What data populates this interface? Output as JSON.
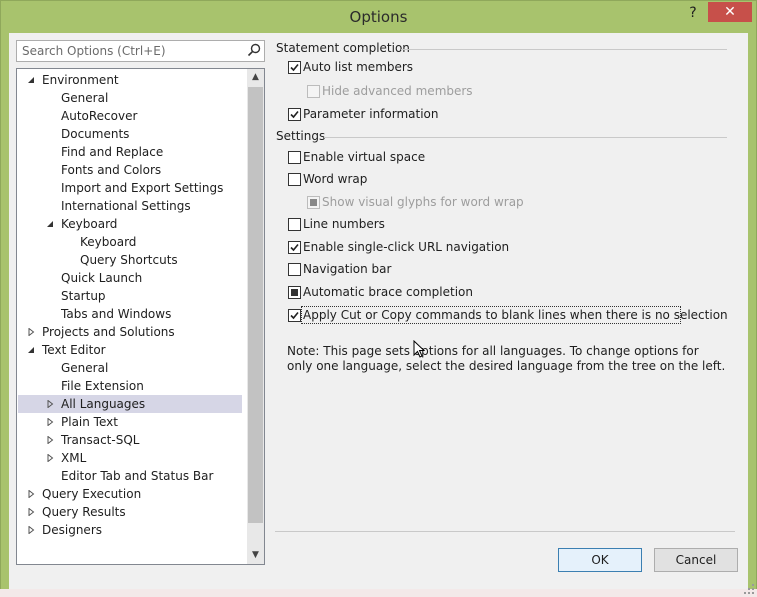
{
  "window": {
    "title": "Options",
    "help_label": "?",
    "close_label": "✕"
  },
  "search": {
    "placeholder": "Search Options (Ctrl+E)"
  },
  "tree": {
    "items": [
      {
        "label": "Environment",
        "expander": "expanded"
      },
      {
        "label": "General"
      },
      {
        "label": "AutoRecover"
      },
      {
        "label": "Documents"
      },
      {
        "label": "Find and Replace"
      },
      {
        "label": "Fonts and Colors"
      },
      {
        "label": "Import and Export Settings"
      },
      {
        "label": "International Settings"
      },
      {
        "label": "Keyboard",
        "expander": "expanded"
      },
      {
        "label": "Keyboard"
      },
      {
        "label": "Query Shortcuts"
      },
      {
        "label": "Quick Launch"
      },
      {
        "label": "Startup"
      },
      {
        "label": "Tabs and Windows"
      },
      {
        "label": "Projects and Solutions",
        "expander": "collapsed"
      },
      {
        "label": "Text Editor",
        "expander": "expanded"
      },
      {
        "label": "General"
      },
      {
        "label": "File Extension"
      },
      {
        "label": "All Languages",
        "expander": "collapsed",
        "selected": true
      },
      {
        "label": "Plain Text",
        "expander": "collapsed"
      },
      {
        "label": "Transact-SQL",
        "expander": "collapsed"
      },
      {
        "label": "XML",
        "expander": "collapsed"
      },
      {
        "label": "Editor Tab and Status Bar"
      },
      {
        "label": "Query Execution",
        "expander": "collapsed"
      },
      {
        "label": "Query Results",
        "expander": "collapsed"
      },
      {
        "label": "Designers",
        "expander": "collapsed"
      }
    ]
  },
  "statement_completion": {
    "header": "Statement completion",
    "auto_list_members": {
      "label": "Auto list members",
      "state": "checked"
    },
    "hide_advanced_members": {
      "label": "Hide advanced members",
      "state": "disabled-unchecked"
    },
    "parameter_information": {
      "label": "Parameter information",
      "state": "checked"
    }
  },
  "settings": {
    "header": "Settings",
    "enable_virtual_space": {
      "label": "Enable virtual space",
      "state": "unchecked"
    },
    "word_wrap": {
      "label": "Word wrap",
      "state": "unchecked"
    },
    "show_visual_glyphs": {
      "label": "Show visual glyphs for word wrap",
      "state": "disabled-indeterminate"
    },
    "line_numbers": {
      "label": "Line numbers",
      "state": "unchecked"
    },
    "single_click_url": {
      "label": "Enable single-click URL navigation",
      "state": "checked"
    },
    "navigation_bar": {
      "label": "Navigation bar",
      "state": "unchecked"
    },
    "automatic_brace": {
      "label": "Automatic brace completion",
      "state": "indeterminate"
    },
    "apply_cut_copy": {
      "label": "Apply Cut or Copy commands to blank lines when there is no selection",
      "state": "checked"
    }
  },
  "note": "Note: This page sets options for all languages. To change options for only one language, select the desired language from the tree on the left.",
  "buttons": {
    "ok": "OK",
    "cancel": "Cancel"
  },
  "colors": {
    "frame": "#a8c36d",
    "close_button": "#c7504a",
    "selection": "#d6d6e6"
  }
}
